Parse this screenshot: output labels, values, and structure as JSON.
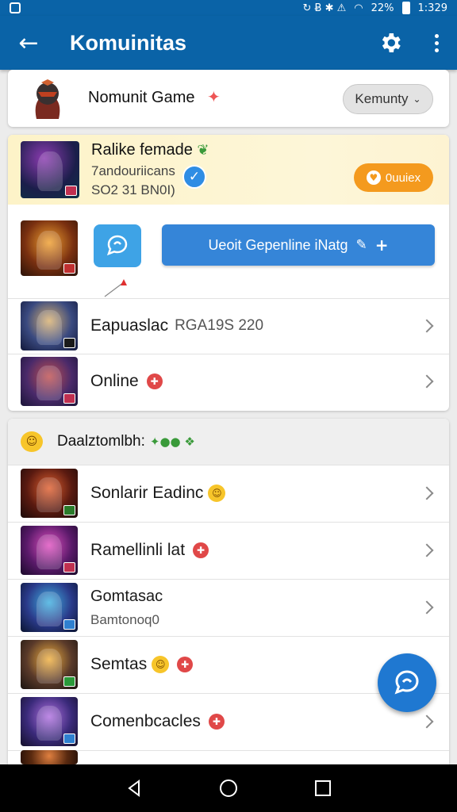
{
  "status_bar": {
    "icons_mid": "↻ Ƀ ✱ ⚠",
    "battery_text": "22%",
    "time": "1:329"
  },
  "app_bar": {
    "title": "Komuinitas"
  },
  "header": {
    "name": "Nomunit Game",
    "dropdown_label": "Kemunty"
  },
  "featured": {
    "title": "Ralike femade",
    "line2": "7andouriicans",
    "line3": "SO2 31 BN0I)",
    "button_label": "0uuiex"
  },
  "action": {
    "button_label": "Ueoit Gepenline iNatg"
  },
  "list_top": [
    {
      "label": "Eapuaslac",
      "extra": "RGA19S 220",
      "art": "art3",
      "badge": "#1a1a1a"
    },
    {
      "label": "Online",
      "extra": "",
      "art": "art4",
      "badge": "#c03050"
    }
  ],
  "section": {
    "title": "Daalztomlbh:",
    "deco": "✦●● ❖"
  },
  "list_bottom": [
    {
      "label": "Sonlarir Eadinc",
      "sub": "",
      "art": "art5",
      "badge": "#2a7a2a"
    },
    {
      "label": "Ramellinli lat",
      "sub": "",
      "art": "art6",
      "badge": "#c03050"
    },
    {
      "label": "Gomtasac",
      "sub": "Bamtonoq0",
      "art": "art7",
      "badge": "#2f80d0"
    },
    {
      "label": "Semtas",
      "sub": "",
      "art": "art8",
      "badge": "#2a9a3a"
    },
    {
      "label": "Comenbcacles",
      "sub": "",
      "art": "art9",
      "badge": "#2f80d0"
    }
  ],
  "colors": {
    "primary": "#0a63a7",
    "accent_blue": "#3585d8",
    "orange": "#f49a1e",
    "red": "#e04848"
  }
}
